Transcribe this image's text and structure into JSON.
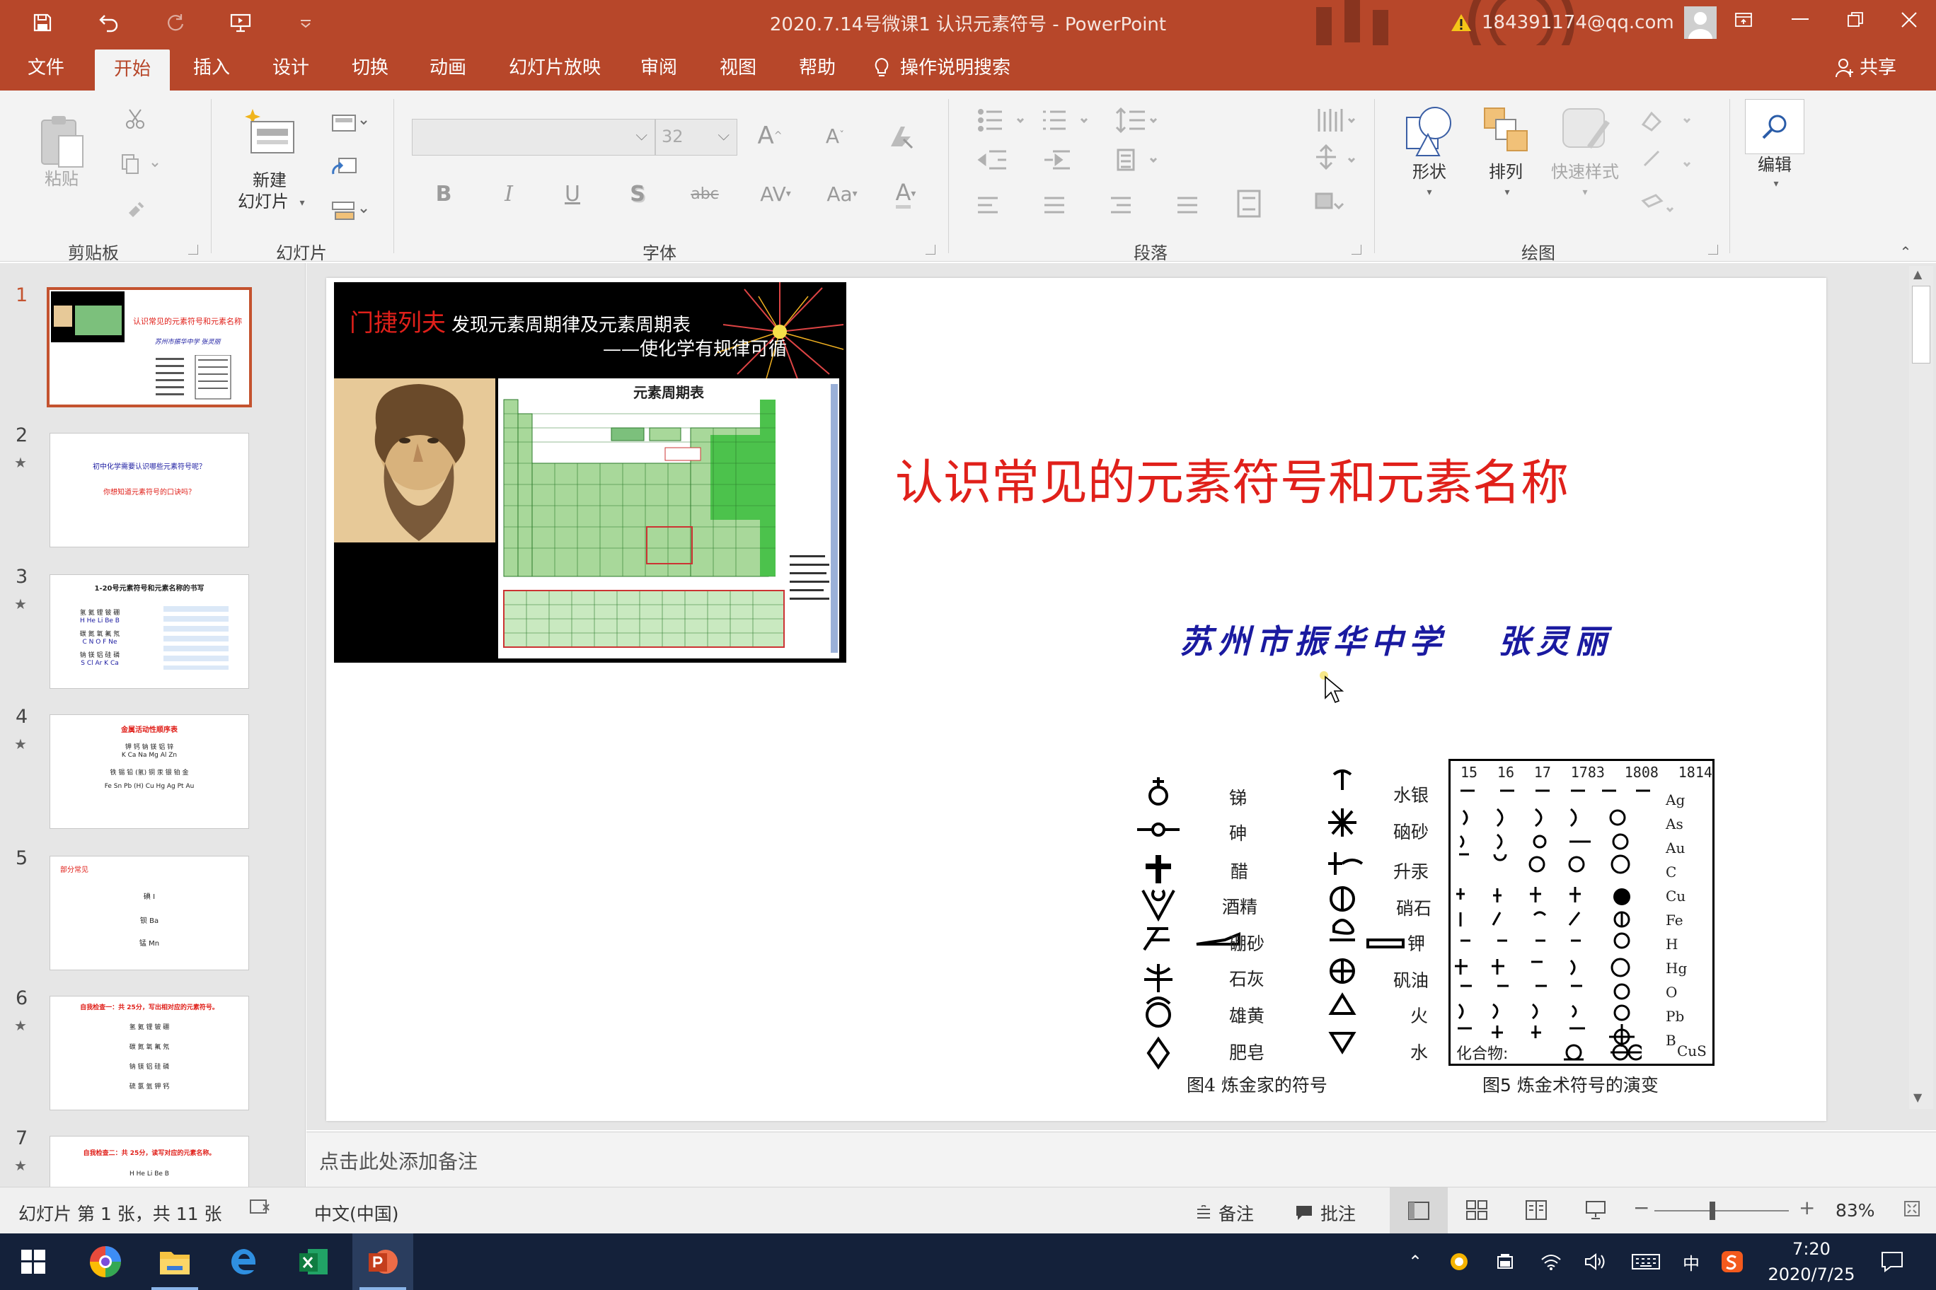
{
  "titlebar": {
    "doc_title": "2020.7.14号微课1 认识元素符号  -  PowerPoint",
    "account": "184391174@qq.com"
  },
  "tabs": [
    "文件",
    "开始",
    "插入",
    "设计",
    "切换",
    "动画",
    "幻灯片放映",
    "审阅",
    "视图",
    "帮助"
  ],
  "active_tab": "开始",
  "tell_me": "操作说明搜索",
  "share": "共享",
  "ribbon": {
    "groups": {
      "clipboard": "剪贴板",
      "slides": "幻灯片",
      "font": "字体",
      "paragraph": "段落",
      "drawing": "绘图"
    },
    "paste": "粘贴",
    "new_slide_l1": "新建",
    "new_slide_l2": "幻灯片",
    "font_size": "32",
    "bold": "B",
    "italic": "I",
    "underline": "U",
    "shadow": "S",
    "strike": "abc",
    "spacing": "AV",
    "change_case": "Aa",
    "font_color": "A",
    "grow": "A",
    "shrink": "A",
    "shapes": "形状",
    "arrange": "排列",
    "quick_styles": "快速样式",
    "edit": "编辑"
  },
  "thumbnails": [
    {
      "num": "1",
      "star": "",
      "lines": [
        "认识常见的元素符号和元素名称",
        "苏州市振华中学 张灵丽"
      ]
    },
    {
      "num": "2",
      "star": "★",
      "lines": [
        "初中化学需要认识哪些元素符号呢？",
        "你想知道元素符号的口诀吗？"
      ]
    },
    {
      "num": "3",
      "star": "★",
      "lines": [
        "1-20号元素符号和元素名称的书写",
        "氢 氦 锂 铍 硼",
        "H He Li Be B",
        "碳 氮 氧 氟 氖",
        "C N O F Ne",
        "钠 镁 铝 硅 磷",
        "S Cl Ar K Ca"
      ]
    },
    {
      "num": "4",
      "star": "★",
      "lines": [
        "金属活动性顺序表",
        "钾 钙 钠 镁 铝 锌",
        "K Ca Na Mg Al Zn",
        "铁 锡 铅 (氢) 铜 汞 银 铂 金",
        "Fe Sn Pb (H) Cu Hg Ag Pt Au"
      ]
    },
    {
      "num": "5",
      "star": "",
      "lines": [
        "部分常见",
        "碘 I",
        "钡 Ba",
        "锰 Mn"
      ]
    },
    {
      "num": "6",
      "star": "★",
      "lines": [
        "自我检查一：共 25分，写出相对应的元素符号。",
        "氢 氦 锂 铍 硼",
        "碳 氮 氧 氟 氖",
        "钠 镁 铝 硅 磷",
        "硫 氯 氩 钾 钙"
      ]
    },
    {
      "num": "7",
      "star": "★",
      "lines": [
        "自我检查二：共 25分，读写对应的元素名称。",
        "H He Li Be B"
      ]
    }
  ],
  "slide": {
    "title": "认识常见的元素符号和元素名称",
    "author": "苏州市振华中学   张灵丽",
    "img_banner": "门捷列夫",
    "img_banner2": "发现元素周期律及元素周期表",
    "img_subtitle": "——使化学有规律可循",
    "img_table_title": "元素周期表",
    "alchemy": {
      "left_labels": [
        "锑",
        "砷",
        "醋",
        "酒精",
        "硼砂",
        "石灰",
        "雄黄",
        "肥皂"
      ],
      "right_labels": [
        "水银",
        "硇砂",
        "升汞",
        "硝石",
        "钾",
        "矾油",
        "火",
        "水"
      ],
      "years": [
        "15",
        "16",
        "17",
        "1783",
        "1808",
        "1814"
      ],
      "symbols": [
        "Ag",
        "As",
        "Au",
        "C",
        "Cu",
        "Fe",
        "H",
        "Hg",
        "O",
        "Pb",
        "B",
        "CuS"
      ],
      "compound_label": "化合物:",
      "caption4": "图4  炼金家的符号",
      "caption5": "图5  炼金术符号的演变"
    }
  },
  "notes_placeholder": "点击此处添加备注",
  "status": {
    "slide_info": "幻灯片 第 1 张，共 11 张",
    "language": "中文(中国)",
    "notes": "备注",
    "comments": "批注",
    "zoom": "83%"
  },
  "taskbar": {
    "ime": "中",
    "time": "7:20",
    "date": "2020/7/25"
  },
  "colors": {
    "brand": "#b7472a",
    "title_red": "#e0201a",
    "author_blue": "#1a1aa0"
  }
}
